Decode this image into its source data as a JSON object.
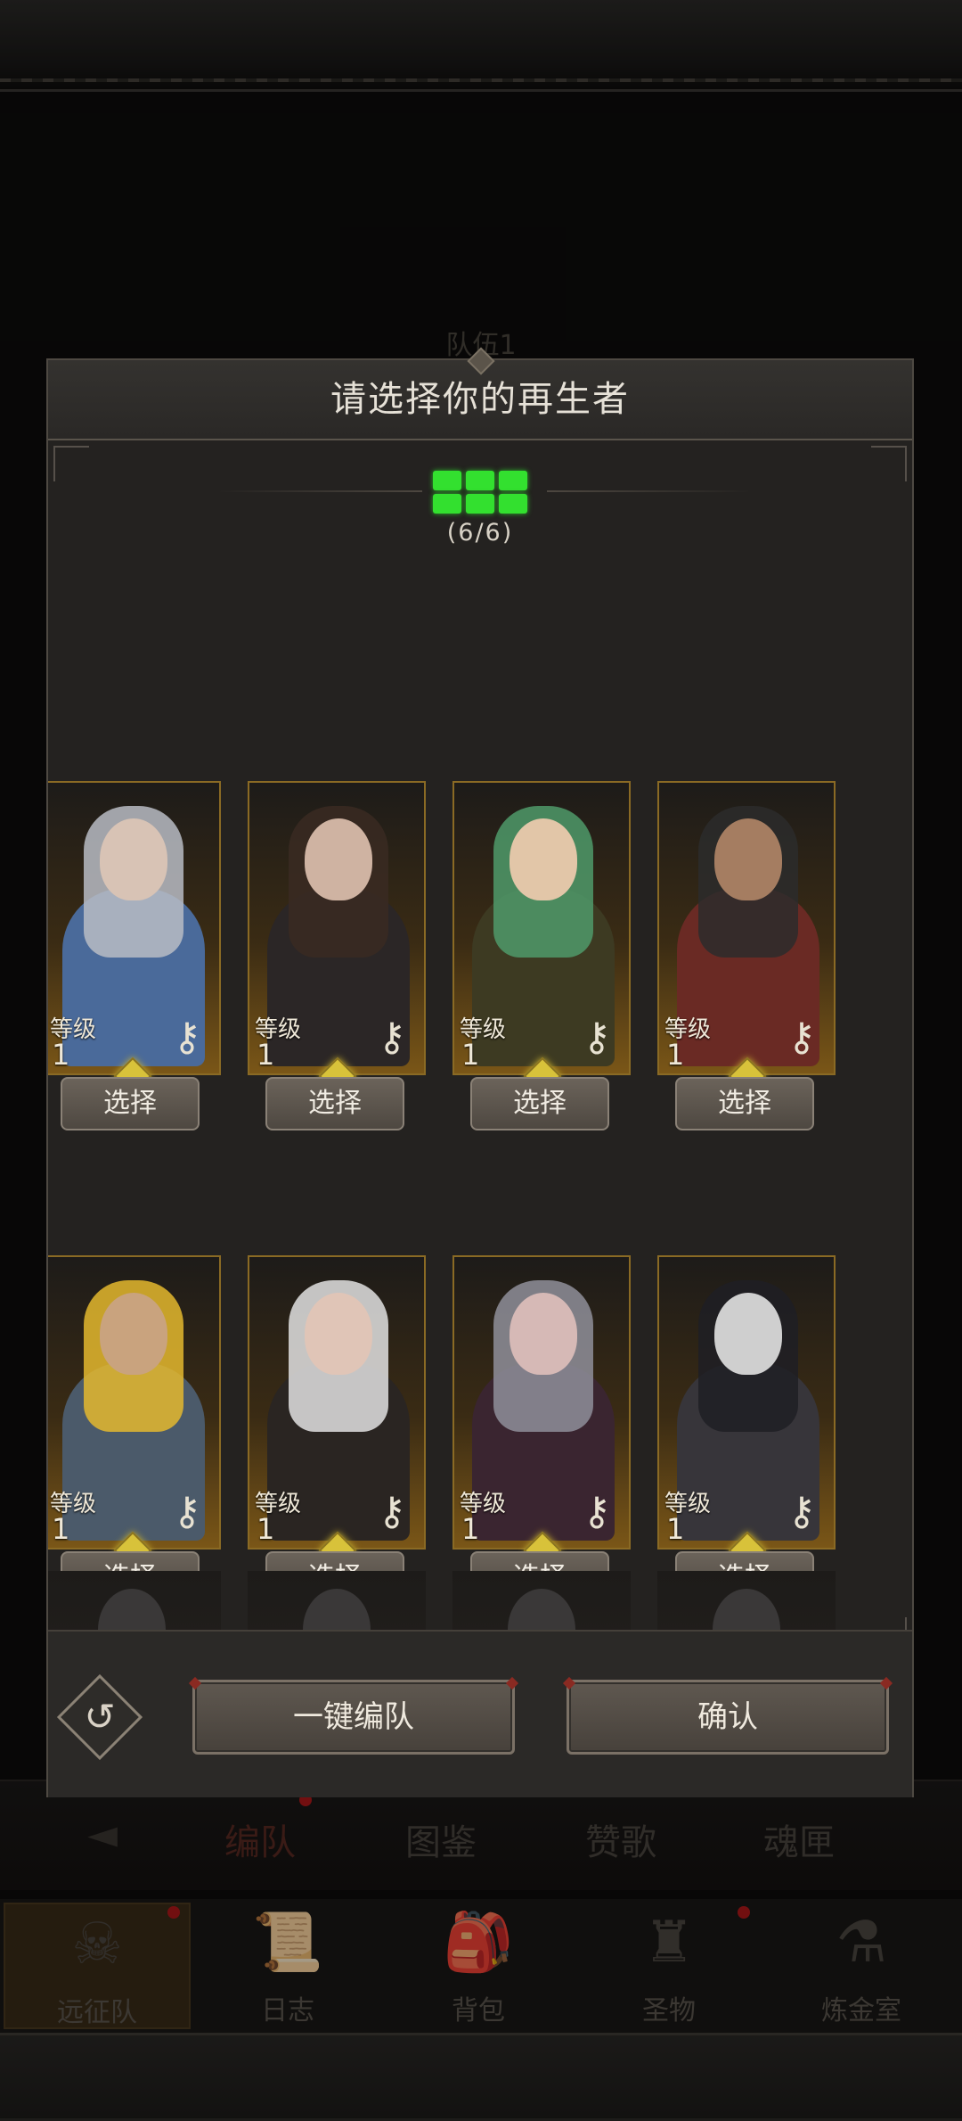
{
  "background": {
    "team_label": "队伍1",
    "tabs": [
      {
        "label": "编队",
        "active": true
      },
      {
        "label": "图鉴",
        "active": false
      },
      {
        "label": "赞歌",
        "active": false
      },
      {
        "label": "魂匣",
        "active": false
      }
    ],
    "bottom_nav": [
      {
        "label": "远征队",
        "icon": "helmet-icon",
        "active": true
      },
      {
        "label": "日志",
        "icon": "scroll-icon",
        "active": false
      },
      {
        "label": "背包",
        "icon": "backpack-icon",
        "active": false
      },
      {
        "label": "圣物",
        "icon": "chalice-icon",
        "active": false
      },
      {
        "label": "炼金室",
        "icon": "alchemy-icon",
        "active": false
      }
    ]
  },
  "modal": {
    "title": "请选择你的再生者",
    "selection_count": "(6/6)",
    "slots_filled": 6,
    "slots_total": 6,
    "slot_color": "#33e02f",
    "level_label": "等级",
    "select_label": "选择",
    "heroes": [
      {
        "level": "1",
        "icon": "key-icon"
      },
      {
        "level": "1",
        "icon": "key-icon"
      },
      {
        "level": "1",
        "icon": "key-icon"
      },
      {
        "level": "1",
        "icon": "key-icon"
      },
      {
        "level": "1",
        "icon": "key-icon"
      },
      {
        "level": "1",
        "icon": "key-icon"
      },
      {
        "level": "1",
        "icon": "key-icon"
      },
      {
        "level": "1",
        "icon": "key-icon"
      }
    ],
    "footer": {
      "auto_team_label": "一键编队",
      "confirm_label": "确认",
      "reset_icon": "undo-icon"
    }
  }
}
